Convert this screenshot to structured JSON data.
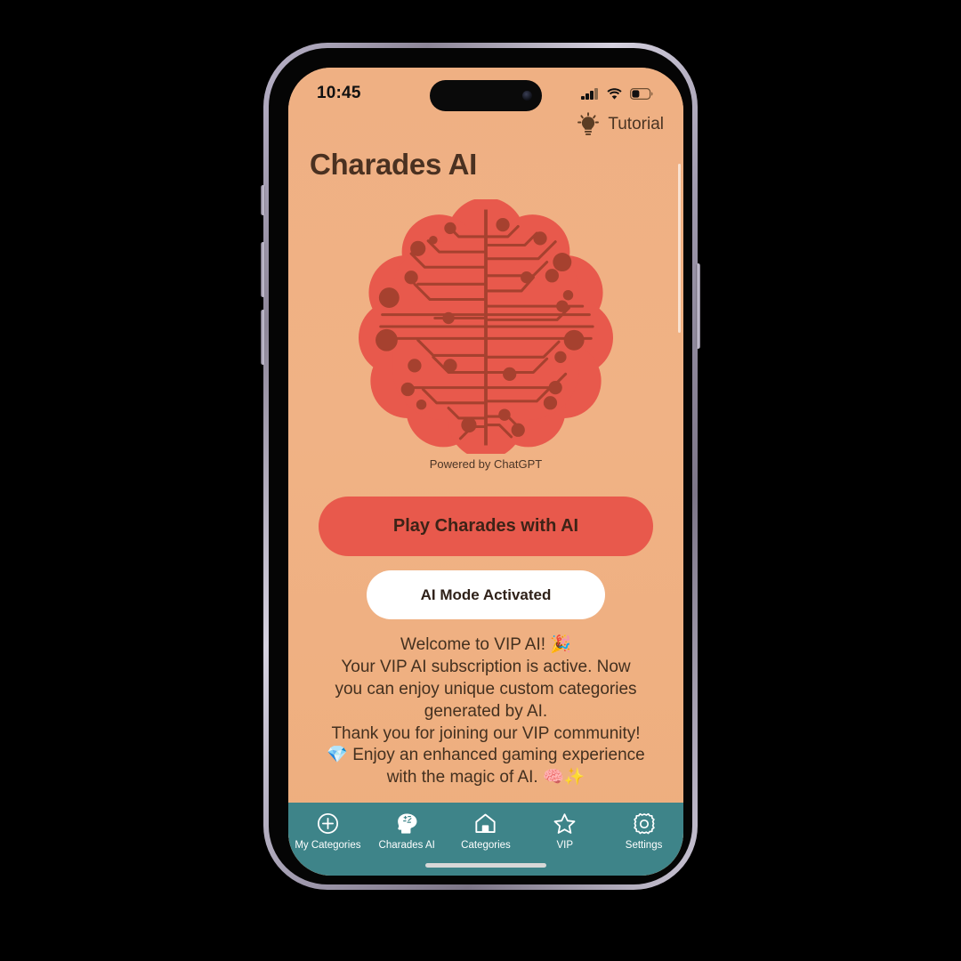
{
  "status_bar": {
    "time": "10:45",
    "cellular_icon": "cellular-bars-icon",
    "wifi_icon": "wifi-icon",
    "battery_icon": "battery-icon",
    "battery_level_pct": 35
  },
  "header": {
    "tutorial_label": "Tutorial",
    "tutorial_icon": "lightbulb-icon",
    "app_title": "Charades AI"
  },
  "hero": {
    "illustration_name": "ai-brain-circuit-illustration",
    "brain_color": "#e8594c",
    "circuit_color": "#a6412f",
    "caption": "Powered by ChatGPT"
  },
  "actions": {
    "play_label": "Play Charades with AI",
    "play_color": "#e8594c",
    "ai_mode_label": "AI Mode Activated",
    "ai_mode_color": "#ffffff"
  },
  "vip_message": {
    "lines": [
      "Welcome to VIP AI! 🎉",
      "Your VIP AI subscription is active. Now",
      "you can enjoy unique custom categories",
      "generated by AI.",
      "Thank you for joining our VIP community!",
      "💎 Enjoy an enhanced gaming experience",
      "with the magic of AI. 🧠✨"
    ]
  },
  "tab_bar": {
    "background": "#3e8489",
    "items": [
      {
        "label": "My Categories",
        "icon": "plus-circle-icon"
      },
      {
        "label": "Charades AI",
        "icon": "brain-head-icon"
      },
      {
        "label": "Categories",
        "icon": "home-icon"
      },
      {
        "label": "VIP",
        "icon": "star-icon"
      },
      {
        "label": "Settings",
        "icon": "gear-icon"
      }
    ]
  },
  "theme": {
    "background": "#efb083",
    "text_dark": "#43301f",
    "accent": "#e8594c",
    "tab_teal": "#3e8489"
  }
}
